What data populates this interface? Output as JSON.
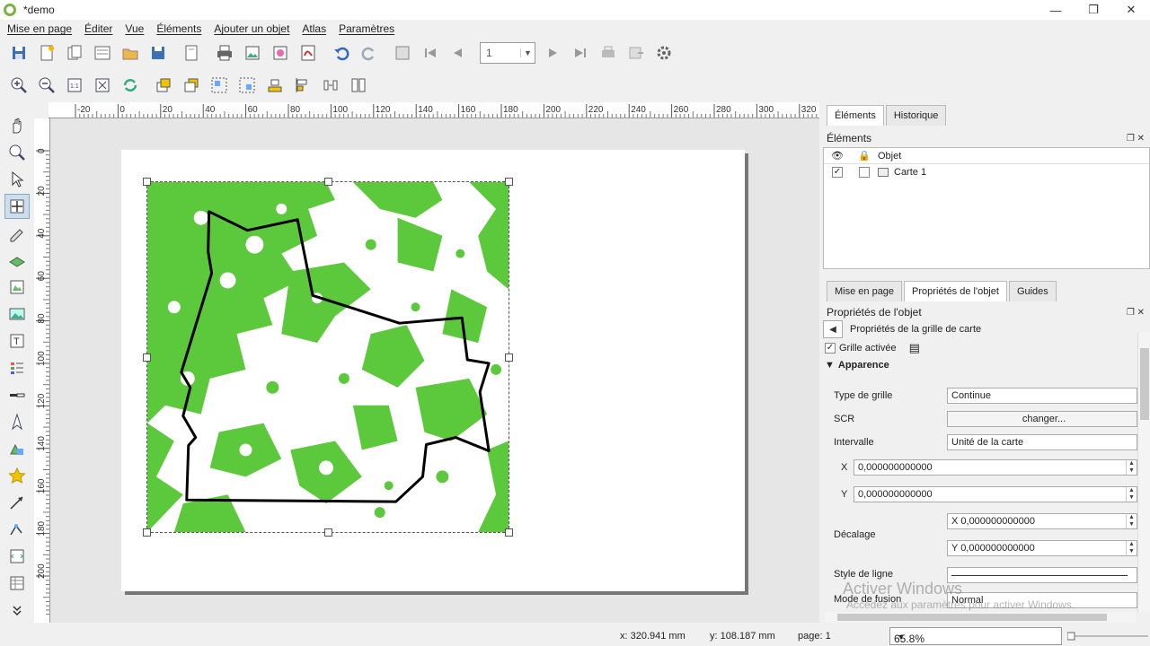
{
  "window": {
    "title": "*demo"
  },
  "menu": [
    "Mise en page",
    "Éditer",
    "Vue",
    "Éléments",
    "Ajouter un objet",
    "Atlas",
    "Paramètres"
  ],
  "toolbar": {
    "page_value": "1"
  },
  "ruler_h": [
    "-20",
    "0",
    "20",
    "40",
    "60",
    "80",
    "100",
    "120",
    "140",
    "160",
    "180",
    "200",
    "220",
    "240",
    "260",
    "280",
    "300",
    "320"
  ],
  "ruler_v": [
    "0",
    "20",
    "40",
    "60",
    "80",
    "100",
    "120",
    "140",
    "160",
    "180",
    "200"
  ],
  "right_panel": {
    "top_tabs": [
      "Éléments",
      "Historique"
    ],
    "elements_title": "Éléments",
    "column_object": "Objet",
    "items": [
      {
        "name": "Carte 1",
        "visible": true,
        "locked": false
      }
    ],
    "prop_tabs": [
      "Mise en page",
      "Propriétés de l'objet",
      "Guides"
    ],
    "props_title": "Propriétés de l'objet",
    "sub_title": "Propriétés de la grille de carte",
    "grid_enabled_label": "Grille activée",
    "appearance_label": "Apparence",
    "grid_type_label": "Type de grille",
    "grid_type_value": "Continue",
    "crs_label": "SCR",
    "crs_button": "changer...",
    "interval_label": "Intervalle",
    "interval_unit": "Unité de la carte",
    "x_label": "X",
    "x_value": "0,000000000000",
    "y_label": "Y",
    "y_value": "0,000000000000",
    "offset_label": "Décalage",
    "offset_x": "X 0,000000000000",
    "offset_y": "Y 0,000000000000",
    "line_style_label": "Style de ligne",
    "blend_label": "Mode de fusion",
    "blend_value": "Normal"
  },
  "watermark": {
    "line1": "Activer Windows",
    "line2": "Accédez aux paramètres pour activer Windows."
  },
  "status": {
    "x": "x: 320.941 mm",
    "y": "y: 108.187 mm",
    "page": "page: 1",
    "zoom": "65.8%"
  },
  "colors": {
    "map_green": "#5cc83c",
    "outline": "#000000"
  }
}
